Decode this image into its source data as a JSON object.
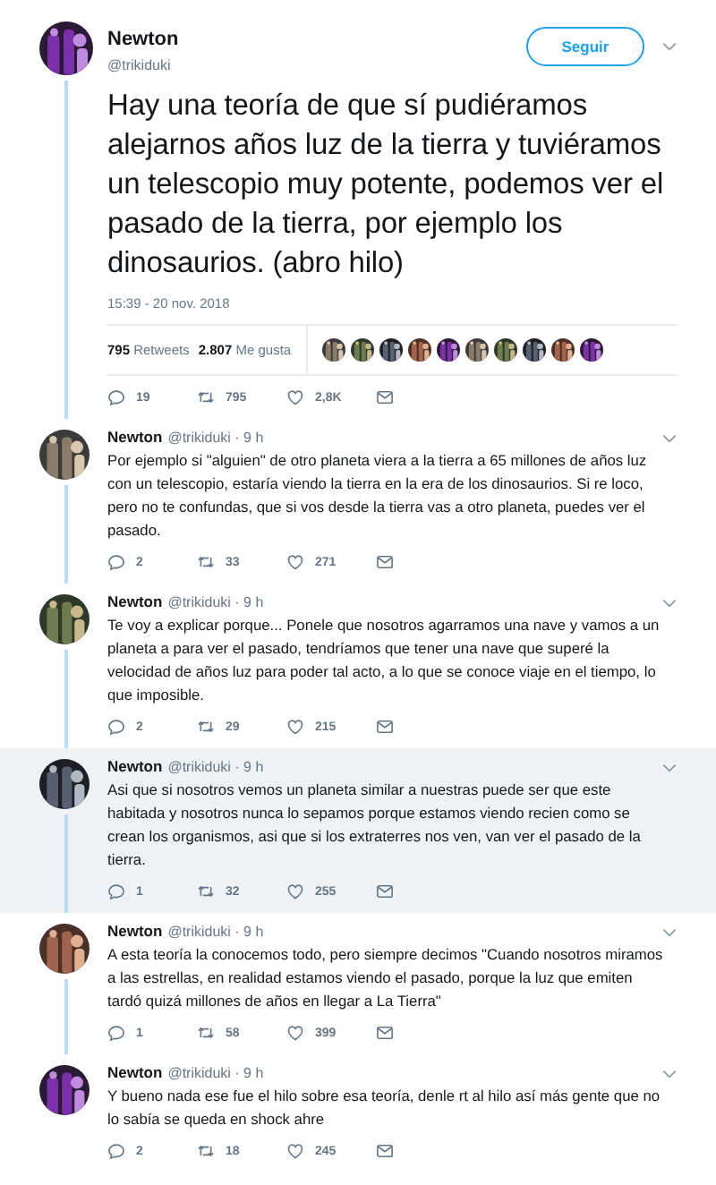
{
  "main_tweet": {
    "name": "Newton",
    "handle": "@trikiduki",
    "follow_button": "Seguir",
    "text": "Hay una teoría de que sí pudiéramos alejarnos años luz de la tierra y tuviéramos un telescopio muy potente, podemos ver el pasado de la tierra, por ejemplo los dinosaurios. (abro hilo)",
    "timestamp": "15:39 - 20 nov. 2018",
    "stats": [
      {
        "count": "795",
        "label": "Retweets"
      },
      {
        "count": "2.807",
        "label": "Me gusta"
      }
    ],
    "actions": {
      "replies": "19",
      "retweets": "795",
      "likes": "2,8K"
    }
  },
  "replies": [
    {
      "name": "Newton",
      "meta": "@trikiduki · 9 h",
      "highlighted": false,
      "text": "Por ejemplo si \"alguien\" de otro planeta viera a la tierra a 65 millones de años luz con un telescopio, estaría viendo la tierra en la era de los dinosaurios. Si re loco, pero no te confundas, que si vos desde la tierra vas a  otro planeta, puedes ver el pasado.",
      "actions": {
        "replies": "2",
        "retweets": "33",
        "likes": "271"
      }
    },
    {
      "name": "Newton",
      "meta": "@trikiduki · 9 h",
      "highlighted": false,
      "text": "Te voy a explicar porque... Ponele que nosotros agarramos una nave y vamos a un planeta a para ver el pasado, tendríamos que tener una nave que superé la velocidad de años luz para poder tal acto, a lo que se conoce viaje en el tiempo, lo que imposible.",
      "actions": {
        "replies": "2",
        "retweets": "29",
        "likes": "215"
      }
    },
    {
      "name": "Newton",
      "meta": "@trikiduki · 9 h",
      "highlighted": true,
      "text": "Asi que si nosotros vemos un planeta similar a nuestras puede ser que este habitada y nosotros nunca lo sepamos porque estamos viendo recien como se crean los organismos, asi que si los extraterres nos ven, van ver el pasado de la tierra.",
      "actions": {
        "replies": "1",
        "retweets": "32",
        "likes": "255"
      }
    },
    {
      "name": "Newton",
      "meta": "@trikiduki · 9 h",
      "highlighted": false,
      "text": "A esta teoría la conocemos todo, pero siempre decimos \"Cuando nosotros miramos a las estrellas, en realidad estamos viendo el pasado, porque la luz que emiten tardó quizá millones de años en llegar a La Tierra\"",
      "actions": {
        "replies": "1",
        "retweets": "58",
        "likes": "399"
      }
    },
    {
      "name": "Newton",
      "meta": "@trikiduki · 9 h",
      "highlighted": false,
      "text": "Y bueno nada ese fue el hilo sobre esa teoría, denle rt al hilo así más gente que no lo sabía se queda en shock ahre",
      "actions": {
        "replies": "2",
        "retweets": "18",
        "likes": "245"
      }
    }
  ]
}
